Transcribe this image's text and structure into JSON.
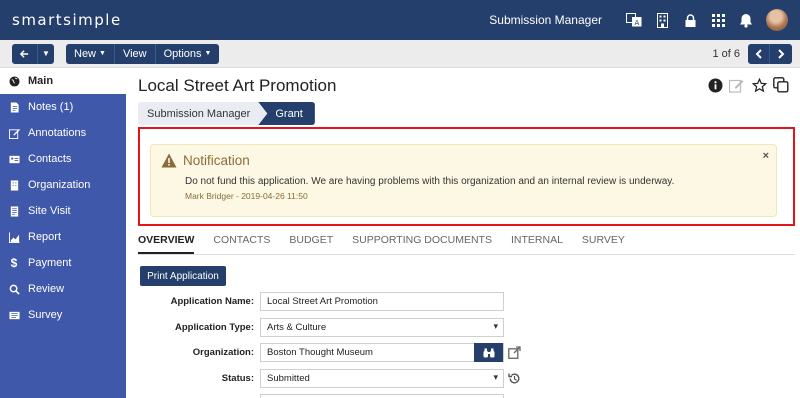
{
  "app": {
    "logo": "smartsimple",
    "module": "Submission Manager"
  },
  "toolbar": {
    "back_icon": "arrow-left-icon",
    "new_label": "New",
    "view_label": "View",
    "options_label": "Options",
    "pager": "1 of 6"
  },
  "sidebar": {
    "items": [
      {
        "label": "Main",
        "icon": "globe-icon"
      },
      {
        "label": "Notes (1)",
        "icon": "note-icon"
      },
      {
        "label": "Annotations",
        "icon": "pencil-icon"
      },
      {
        "label": "Contacts",
        "icon": "contact-card-icon"
      },
      {
        "label": "Organization",
        "icon": "building-icon"
      },
      {
        "label": "Site Visit",
        "icon": "document-icon"
      },
      {
        "label": "Report",
        "icon": "chart-icon"
      },
      {
        "label": "Payment",
        "icon": "dollar-icon"
      },
      {
        "label": "Review",
        "icon": "search-icon"
      },
      {
        "label": "Survey",
        "icon": "survey-icon"
      }
    ]
  },
  "page": {
    "title": "Local Street Art Promotion",
    "breadcrumb": [
      "Submission Manager",
      "Grant"
    ]
  },
  "notification": {
    "title": "Notification",
    "message": "Do not fund this application. We are having problems with this organization and an internal review is underway.",
    "meta": "Mark Bridger - 2019-04-26 11:50",
    "close": "×"
  },
  "tabs": [
    "OVERVIEW",
    "CONTACTS",
    "BUDGET",
    "SUPPORTING DOCUMENTS",
    "INTERNAL",
    "SURVEY"
  ],
  "print_label": "Print Application",
  "form": {
    "application_name": {
      "label": "Application Name:",
      "value": "Local Street Art Promotion"
    },
    "application_type": {
      "label": "Application Type:",
      "value": "Arts & Culture"
    },
    "organization": {
      "label": "Organization:",
      "value": "Boston Thought Museum"
    },
    "status": {
      "label": "Status:",
      "value": "Submitted"
    }
  },
  "colors": {
    "navy": "#243f6b",
    "sidebar": "#3f58a9",
    "warning_bg": "#fcf8e3",
    "highlight": "#e0161b"
  }
}
